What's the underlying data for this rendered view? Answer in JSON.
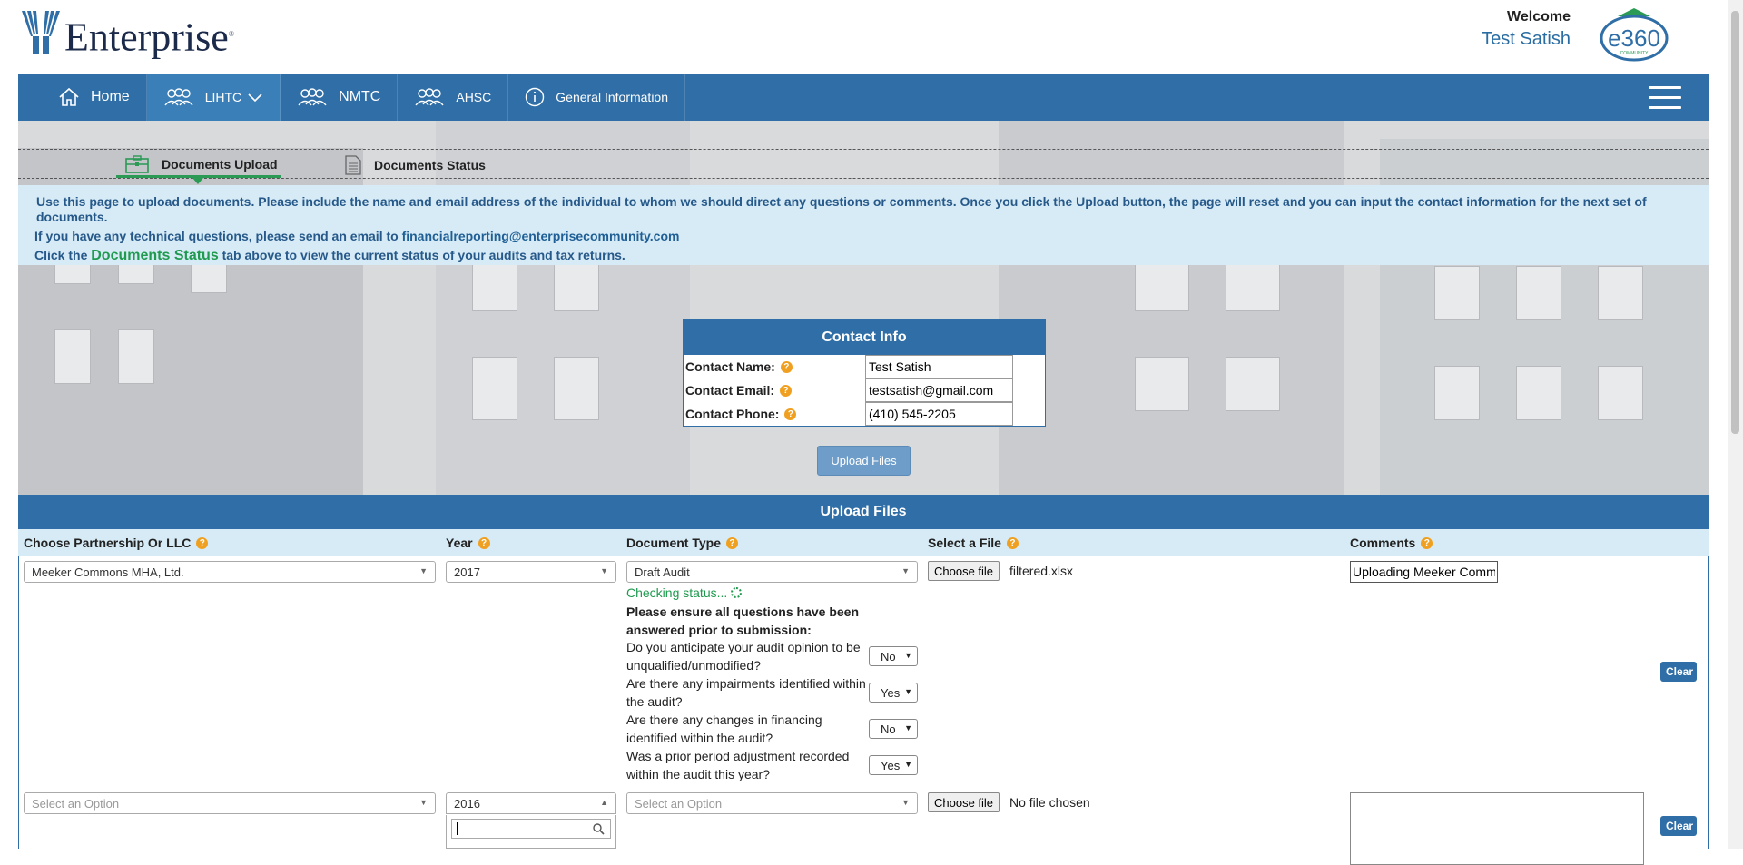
{
  "header": {
    "logo_text": "Enterprise",
    "logo_reg": "®",
    "welcome_label": "Welcome",
    "user_name": "Test Satish",
    "badge_text": "e360",
    "badge_sub": "COMMUNITY"
  },
  "nav": {
    "items": [
      {
        "label": "Home",
        "icon": "home-icon"
      },
      {
        "label": "LIHTC",
        "icon": "people-icon",
        "active": true,
        "dropdown": true
      },
      {
        "label": "NMTC",
        "icon": "people-icon"
      },
      {
        "label": "AHSC",
        "icon": "people-icon"
      },
      {
        "label": "General Information",
        "icon": "info-icon"
      }
    ]
  },
  "tabs": [
    {
      "label": "Documents Upload",
      "active": true,
      "icon": "briefcase-icon"
    },
    {
      "label": "Documents Status",
      "active": false,
      "icon": "document-icon"
    }
  ],
  "info": {
    "line1": "Use this page to upload documents. Please include the name and email address of the individual to whom we should direct any questions or comments. Once you click the Upload button, the page will reset and you can input the contact information for the next set of documents.",
    "line2_prefix": "If you have any technical questions, please send an email to",
    "email": "financialreporting@enterprisecommunity.com",
    "line3_prefix": "Click the",
    "status_link": "Documents Status",
    "line3_suffix": "tab above to view the current status of your audits and tax returns."
  },
  "contact": {
    "title": "Contact Info",
    "name_label": "Contact Name:",
    "name_value": "Test Satish",
    "email_label": "Contact Email:",
    "email_value": "testsatish@gmail.com",
    "phone_label": "Contact Phone:",
    "phone_value": "(410) 545-2205",
    "help_glyph": "?"
  },
  "upload_top_button": "Upload Files",
  "upload_panel": {
    "title": "Upload Files",
    "columns": {
      "partnership": "Choose Partnership Or LLC",
      "year": "Year",
      "doc_type": "Document Type",
      "file": "Select a File",
      "comments": "Comments"
    },
    "row1": {
      "partnership": "Meeker Commons MHA, Ltd.",
      "year": "2017",
      "doc_type": "Draft Audit",
      "choose_file": "Choose file",
      "file_name": "filtered.xlsx",
      "comment": "Uploading Meeker Comm",
      "checking": "Checking status...",
      "ensure": "Please ensure all questions have been answered prior to submission:",
      "questions": [
        {
          "text": "Do you anticipate your audit opinion to be unqualified/unmodified?",
          "answer": "No"
        },
        {
          "text": "Are there any impairments identified within the audit?",
          "answer": "Yes"
        },
        {
          "text": "Are there any changes in financing identified within the audit?",
          "answer": "No"
        },
        {
          "text": "Was a prior period adjustment recorded within the audit this year?",
          "answer": "Yes"
        }
      ],
      "clear": "Clear"
    },
    "row2": {
      "partnership": "Select an Option",
      "year": "2016",
      "doc_type": "Select an Option",
      "choose_file": "Choose file",
      "file_name": "No file chosen",
      "comment": "",
      "clear": "Clear"
    }
  },
  "colors": {
    "nav_blue": "#2f6ea6",
    "info_bg": "#d7ebf6",
    "accent_green": "#2a9a55",
    "help_orange": "#f0a020"
  }
}
